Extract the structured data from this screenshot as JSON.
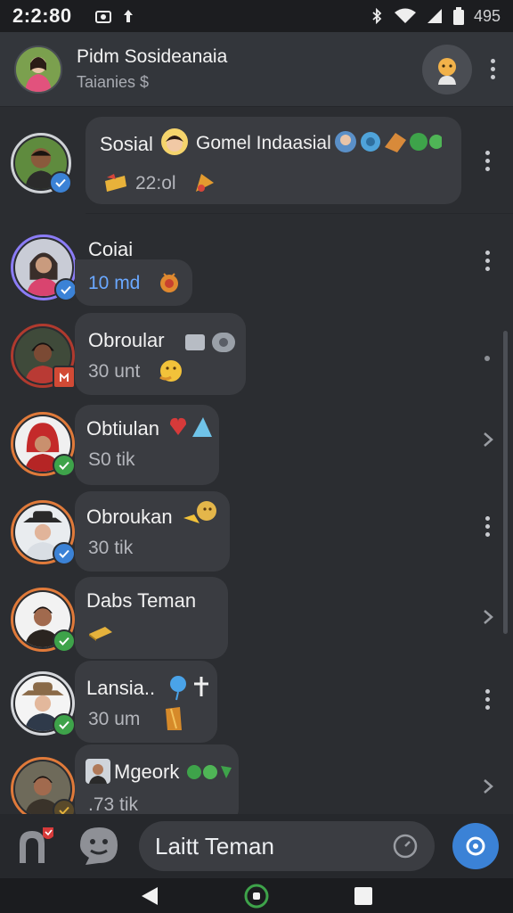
{
  "status_bar": {
    "time": "2:2:80",
    "battery_text": "495"
  },
  "header": {
    "title": "Pidm Sosideanaia",
    "subtitle": "Taianies $"
  },
  "chats": [
    {
      "name": "Sosial",
      "name2": "Gomel Indaasial",
      "meta": "22:ol",
      "action": "more"
    },
    {
      "name": "Coiai",
      "meta": "10 md",
      "action": "more"
    },
    {
      "name": "Obroular",
      "meta": "30 unt",
      "action": "more"
    },
    {
      "name": "Obtiulan",
      "meta": "S0 tik",
      "action": "open"
    },
    {
      "name": "Obroukan",
      "meta": "30 tik",
      "action": "more"
    },
    {
      "name": "Dabs Teman",
      "meta": "",
      "action": "open"
    },
    {
      "name": "Lansia..",
      "meta": "30 um",
      "action": "more"
    },
    {
      "name": "Mgeork",
      "meta": ".73 tik",
      "action": "open"
    }
  ],
  "composer": {
    "input_value": "Laitt Teman"
  },
  "colors": {
    "accent": "#3b82d6",
    "verify_green": "#3ea34a",
    "verify_blue": "#3b82d6",
    "ring": "#e07a3a"
  },
  "icons": {
    "status_left": [
      "camera-icon",
      "upload-icon"
    ],
    "status_right": [
      "bluetooth-icon",
      "wifi-icon",
      "signal-icon",
      "battery-icon"
    ],
    "bottom": [
      "contacts-icon",
      "emoji-icon",
      "clock-icon",
      "send-icon"
    ],
    "nav": [
      "back-icon",
      "home-icon",
      "recents-icon"
    ]
  }
}
